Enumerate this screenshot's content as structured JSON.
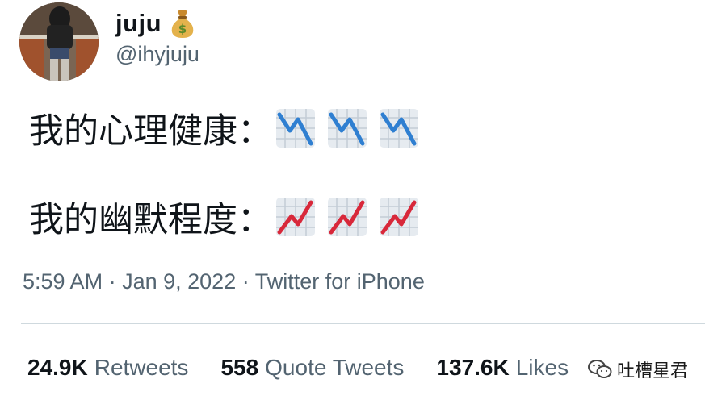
{
  "user": {
    "display_name": "juju",
    "name_emoji": "money-bag-icon",
    "handle": "@ihyjuju"
  },
  "tweet": {
    "line1_text": "我的心理健康：",
    "line1_emoji": [
      "chart-decreasing-icon",
      "chart-decreasing-icon",
      "chart-decreasing-icon"
    ],
    "line2_text": "我的幽默程度：",
    "line2_emoji": [
      "chart-increasing-icon",
      "chart-increasing-icon",
      "chart-increasing-icon"
    ]
  },
  "meta": {
    "time": "5:59 AM",
    "separator": "·",
    "date": "Jan 9, 2022",
    "source": "Twitter for iPhone"
  },
  "stats": {
    "retweets_count": "24.9K",
    "retweets_label": "Retweets",
    "quotes_count": "558",
    "quotes_label": "Quote Tweets",
    "likes_count": "137.6K",
    "likes_label": "Likes"
  },
  "watermark": {
    "text": "吐槽星君"
  },
  "colors": {
    "text": "#0f1419",
    "secondary": "#536471",
    "divider": "#cfd9de",
    "chart_down": "#2f7fd1",
    "chart_up": "#d8283a"
  }
}
